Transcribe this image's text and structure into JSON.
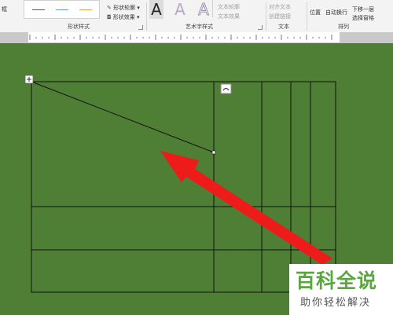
{
  "ribbon": {
    "left_partial": "框",
    "shape_styles": {
      "group_label": "形状样式",
      "outline_label": "形状轮廓",
      "effects_label": "形状效果"
    },
    "wordart": {
      "group_label": "艺术字样式",
      "sample_glyph": "A",
      "text_outline": "文本轮廓",
      "text_effects": "文本效果"
    },
    "text": {
      "group_label": "文本",
      "align_text": "对齐文本",
      "create_link": "创建链接"
    },
    "arrange": {
      "group_label": "排列",
      "position": "位置",
      "wrap_text": "自动换行",
      "send_backward": "下移一层",
      "selection_pane": "选择窗格"
    }
  },
  "watermark": {
    "title": "百科全说",
    "subtitle": "助你轻松解决"
  },
  "colors": {
    "page_background": "#4f7f34",
    "annotation_arrow": "#ee1b1b",
    "watermark_green": "#5aa63f"
  }
}
